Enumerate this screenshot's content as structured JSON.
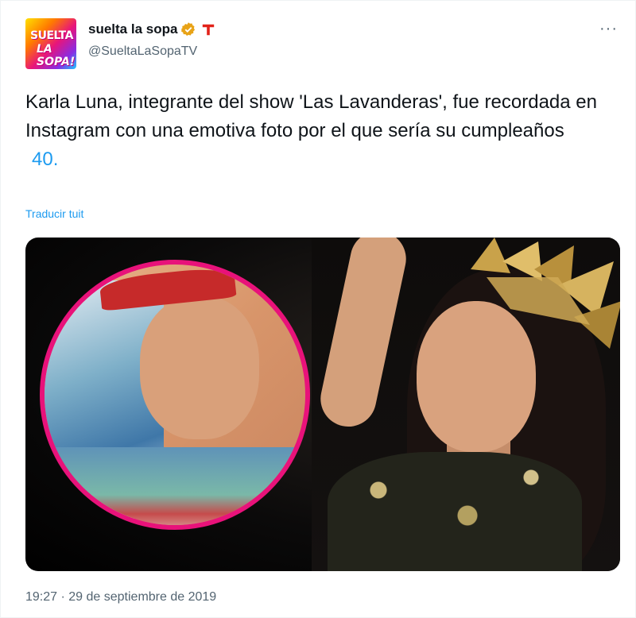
{
  "author": {
    "display_name": "suelta la sopa",
    "handle": "@SueltaLaSopaTV",
    "avatar_text_top": "SUELTA",
    "avatar_text_bottom": "LA SOPA!"
  },
  "tweet": {
    "text": "Karla Luna, integrante del show 'Las Lavanderas', fue recordada en Instagram con una emotiva foto por el que sería su cumpleaños",
    "number": "40.",
    "translate_label": "Traducir tuit",
    "timestamp": "19:27 · 29 de septiembre de 2019"
  },
  "icons": {
    "verified": "verified-badge-icon",
    "brand": "telemundo-logo-icon",
    "more": "more-options-icon"
  },
  "colors": {
    "link": "#1d9bf0",
    "secondary": "#536471",
    "inset_border": "#e8127a"
  }
}
